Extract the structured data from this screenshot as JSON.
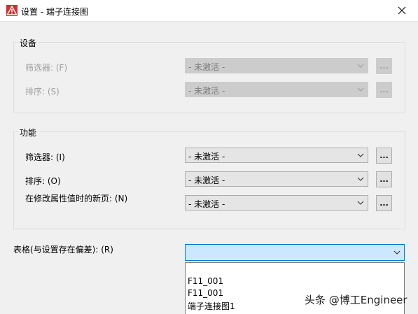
{
  "window": {
    "title": "设置 - 端子连接图"
  },
  "device_group": {
    "label": "设备",
    "filter_label": "筛选器: (F)",
    "filter_value": "- 未激活 -",
    "sort_label": "排序: (S)",
    "sort_value": "- 未激活 -",
    "button_label": "..."
  },
  "function_group": {
    "label": "功能",
    "filter_label": "筛选器: (I)",
    "filter_value": "- 未激活 -",
    "sort_label": "排序: (O)",
    "sort_value": "- 未激活 -",
    "newpage_label": "在修改属性值时的新页: (N)",
    "newpage_value": "- 未激活 -",
    "button_label": "..."
  },
  "table": {
    "label": "表格(与设置存在偏差): (R)",
    "value": "",
    "options": [
      "F11_001",
      "F11_001",
      "端子连接图1",
      "..."
    ]
  },
  "watermark": "头条 @博工Engineer",
  "colors": {
    "accent": "#0078d7",
    "selected_bg": "#cce8ff",
    "app_icon": "#d32f2f"
  }
}
